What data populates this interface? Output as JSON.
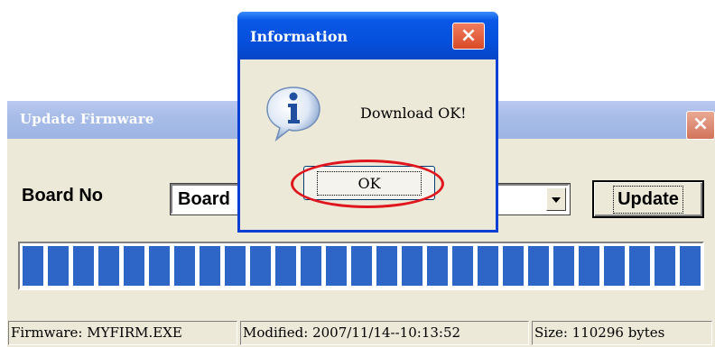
{
  "main_window": {
    "title": "Update Firmware",
    "close_label": "×",
    "board_label": "Board No",
    "board_value": "Board",
    "update_label": "Update",
    "progress": 1.0,
    "status": {
      "firmware": "Firmware: MYFIRM.EXE",
      "modified": "Modified: 2007/11/14--10:13:52",
      "size": "Size: 110296 bytes"
    }
  },
  "dialog": {
    "title": "Information",
    "close_label": "×",
    "message": "Download OK!",
    "ok_label": "OK",
    "icon": "info-icon"
  },
  "colors": {
    "progress_fill": "#2e66c8",
    "dialog_titlebar": "#0550dd",
    "highlight": "#e0161e"
  }
}
